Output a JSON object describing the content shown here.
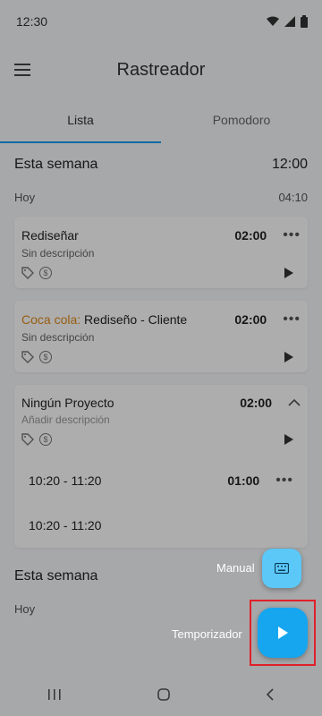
{
  "status": {
    "time": "12:30"
  },
  "app": {
    "title": "Rastreador"
  },
  "tabs": [
    {
      "label": "Lista"
    },
    {
      "label": "Pomodoro"
    }
  ],
  "week": {
    "label": "Esta semana",
    "total": "12:00"
  },
  "day": {
    "label": "Hoy",
    "total": "04:10"
  },
  "entries": [
    {
      "title": "Rediseñar",
      "time": "02:00",
      "desc": "Sin descripción"
    },
    {
      "project": "Coca cola:",
      "title": "Rediseño -  Cliente",
      "time": "02:00",
      "desc": "Sin descripción"
    },
    {
      "title": "Ningún Proyecto",
      "time": "02:00",
      "desc": "Añadir descripción"
    }
  ],
  "sub_entries": [
    {
      "range": "10:20 - 11:20",
      "time": "01:00"
    },
    {
      "range": "10:20 - 11:20"
    }
  ],
  "week2": {
    "label": "Esta semana"
  },
  "day2": {
    "label": "Hoy"
  },
  "fab": {
    "manual_label": "Manual",
    "timer_label": "Temporizador"
  },
  "colors": {
    "accent": "#1a9cf0",
    "project": "#e08a1a",
    "fab_primary": "#15a6ef",
    "fab_secondary": "#5bc8f8",
    "highlight": "#e0202a"
  }
}
